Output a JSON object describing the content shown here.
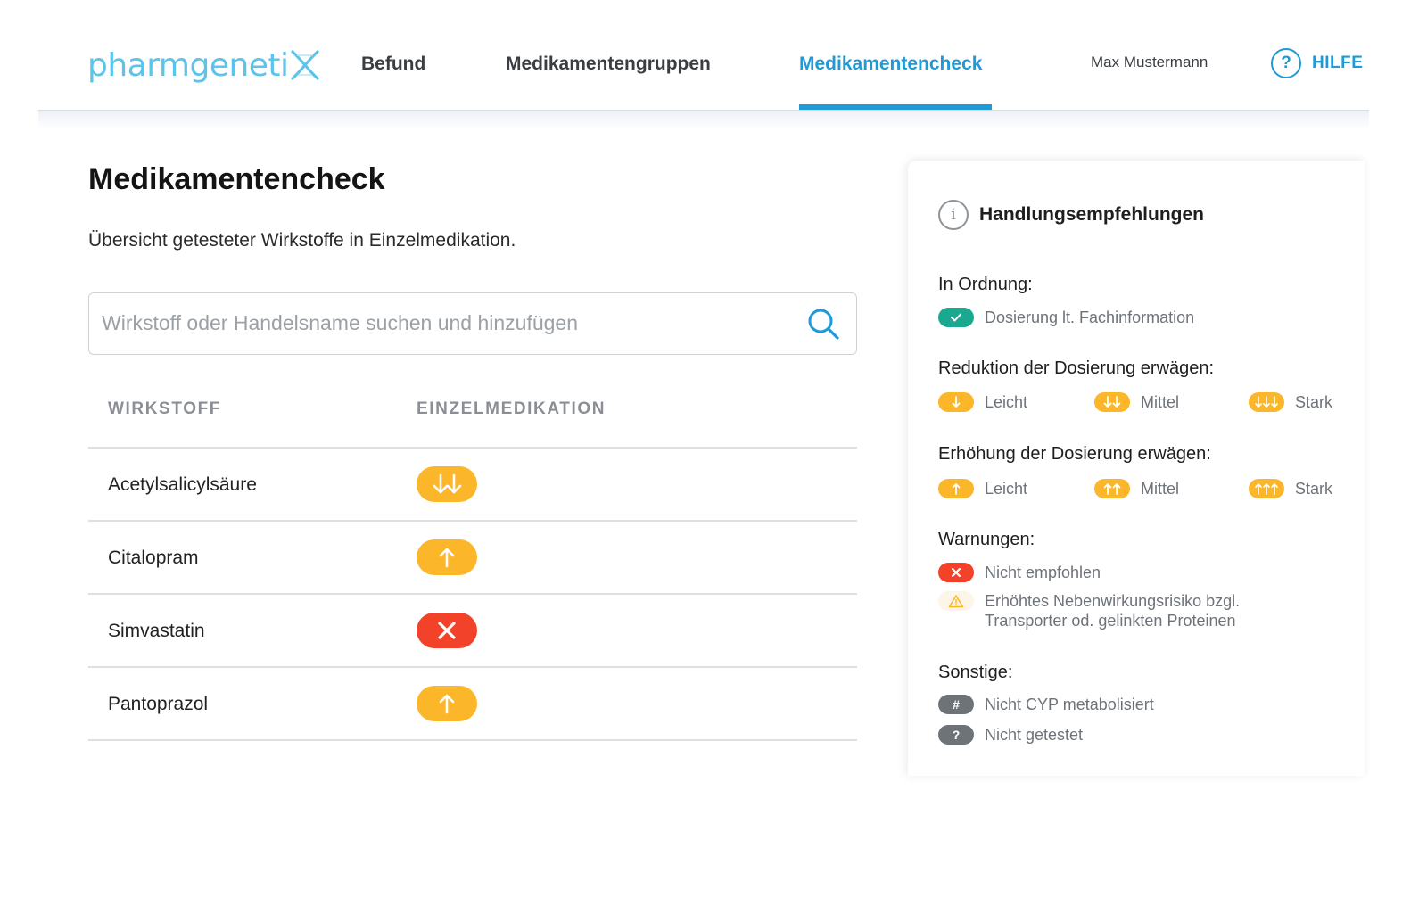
{
  "header": {
    "logo_text": "pharmgeneti",
    "nav": [
      {
        "label": "Befund"
      },
      {
        "label": "Medikamentengruppen"
      },
      {
        "label": "Medikamentencheck",
        "active": true
      }
    ],
    "user_name": "Max Mustermann",
    "help_icon_glyph": "?",
    "help_label": "HILFE",
    "accent_color": "#1e9bd7",
    "logo_color": "#5cc3ea"
  },
  "main": {
    "title": "Medikamentencheck",
    "subtitle": "Übersicht getesteter Wirkstoffe in Einzelmedikation.",
    "search": {
      "placeholder": "Wirkstoff oder Handelsname suchen und hinzufügen",
      "value": "",
      "icon": "search-icon"
    },
    "table": {
      "columns": [
        "WIRKSTOFF",
        "EINZELMEDIKATION"
      ],
      "rows": [
        {
          "name": "Acetylsalicylsäure",
          "status": "reduce-medium",
          "icon": "double-arrow-down-icon",
          "color": "#fbb62a"
        },
        {
          "name": "Citalopram",
          "status": "increase-light",
          "icon": "arrow-up-icon",
          "color": "#fbb62a"
        },
        {
          "name": "Simvastatin",
          "status": "not-recommended",
          "icon": "cross-icon",
          "color": "#f2422a"
        },
        {
          "name": "Pantoprazol",
          "status": "increase-light",
          "icon": "arrow-up-icon",
          "color": "#fbb62a"
        }
      ]
    }
  },
  "panel": {
    "info_glyph": "i",
    "title": "Handlungsempfehlungen",
    "ok": {
      "label": "In Ordnung:",
      "items": [
        {
          "text": "Dosierung lt. Fachinformation",
          "icon": "check-icon",
          "color": "#1aa890"
        }
      ]
    },
    "reduce": {
      "label": "Reduktion der Dosierung erwägen:",
      "items": [
        {
          "text": "Leicht",
          "icon": "arrow-down-icon"
        },
        {
          "text": "Mittel",
          "icon": "double-arrow-down-icon"
        },
        {
          "text": "Stark",
          "icon": "triple-arrow-down-icon"
        }
      ]
    },
    "increase": {
      "label": "Erhöhung der Dosierung erwägen:",
      "items": [
        {
          "text": "Leicht",
          "icon": "arrow-up-icon"
        },
        {
          "text": "Mittel",
          "icon": "double-arrow-up-icon"
        },
        {
          "text": "Stark",
          "icon": "triple-arrow-up-icon"
        }
      ]
    },
    "warnings": {
      "label": "Warnungen:",
      "items": [
        {
          "text": "Nicht empfohlen",
          "icon": "cross-icon",
          "color": "#f2422a"
        },
        {
          "text_line1": "Erhöhtes Nebenwirkungsrisiko bzgl.",
          "text_line2": "Transporter od. gelinkten Proteinen",
          "icon": "warning-triangle-icon",
          "color": "#fbb62a"
        }
      ]
    },
    "other": {
      "label": "Sonstige:",
      "items": [
        {
          "text": "Nicht CYP metabolisiert",
          "icon": "hash-icon",
          "glyph": "#"
        },
        {
          "text": "Nicht getestet",
          "icon": "question-icon",
          "glyph": "?"
        }
      ]
    }
  },
  "colors": {
    "orange": "#fbb62a",
    "red": "#f2422a",
    "green": "#1aa890",
    "grey": "#6e7378"
  }
}
